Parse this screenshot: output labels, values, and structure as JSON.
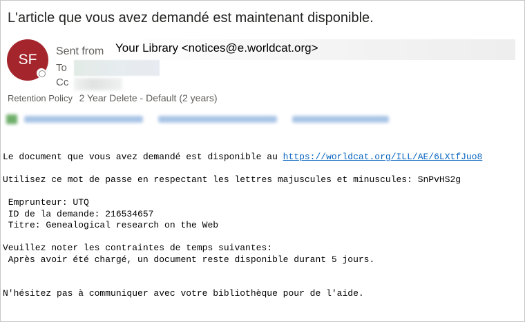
{
  "subject": "L'article que vous avez demandé est maintenant disponible.",
  "sender": {
    "initials": "SF",
    "avatar_color": "#a4262c",
    "from_label": "Sent from",
    "from_value": "Your Library <notices@e.worldcat.org>"
  },
  "to_label": "To",
  "cc_label": "Cc",
  "retention": {
    "label": "Retention Policy",
    "value": "2 Year Delete - Default (2 years)"
  },
  "body": {
    "line1_prefix": "Le document que vous avez demandé est disponible au ",
    "link": "https://worldcat.org/ILL/AE/6LXtfJuo8",
    "line2": "Utilisez ce mot de passe en respectant les lettres majuscules et minuscules: SnPvHS2g",
    "borrower": " Emprunteur: UTQ",
    "request_id": " ID de la demande: 216534657",
    "title": " Titre: Genealogical research on the Web",
    "constraints_heading": "Veuillez noter les contraintes de temps suivantes:",
    "constraint": " Après avoir été chargé, un document reste disponible durant 5 jours.",
    "closing": "N'hésitez pas à communiquer avec votre bibliothèque pour de l'aide."
  }
}
